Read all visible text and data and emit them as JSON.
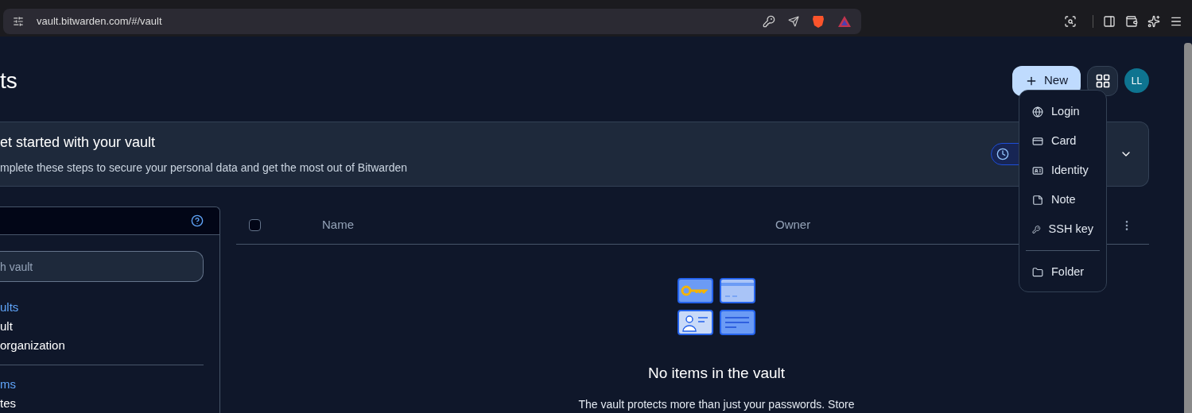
{
  "browser": {
    "url": "vault.bitwarden.com/#/vault"
  },
  "header": {
    "title": "ts",
    "new_button": "New",
    "avatar": "LL"
  },
  "new_menu": {
    "items": [
      {
        "label": "Login",
        "kind": "login"
      },
      {
        "label": "Card",
        "kind": "card"
      },
      {
        "label": "Identity",
        "kind": "identity"
      },
      {
        "label": "Note",
        "kind": "note"
      },
      {
        "label": "SSH key",
        "kind": "ssh"
      },
      {
        "label": "Folder",
        "kind": "folder"
      }
    ]
  },
  "banner": {
    "title": "et started with your vault",
    "subtitle": "mplete these steps to secure your personal data and get the most out of Bitwarden",
    "expanded": false
  },
  "sidebar": {
    "search": {
      "placeholder": "h vault"
    },
    "groups": [
      {
        "heading": "ults",
        "items": [
          "ult",
          "organization"
        ]
      },
      {
        "heading": "ms",
        "items": [
          "tes"
        ]
      }
    ]
  },
  "table": {
    "columns": [
      "Name",
      "Owner"
    ],
    "select_all_checked": false
  },
  "empty_state": {
    "title": "No items in the vault",
    "text": "The vault protects more than just your passwords. Store"
  }
}
